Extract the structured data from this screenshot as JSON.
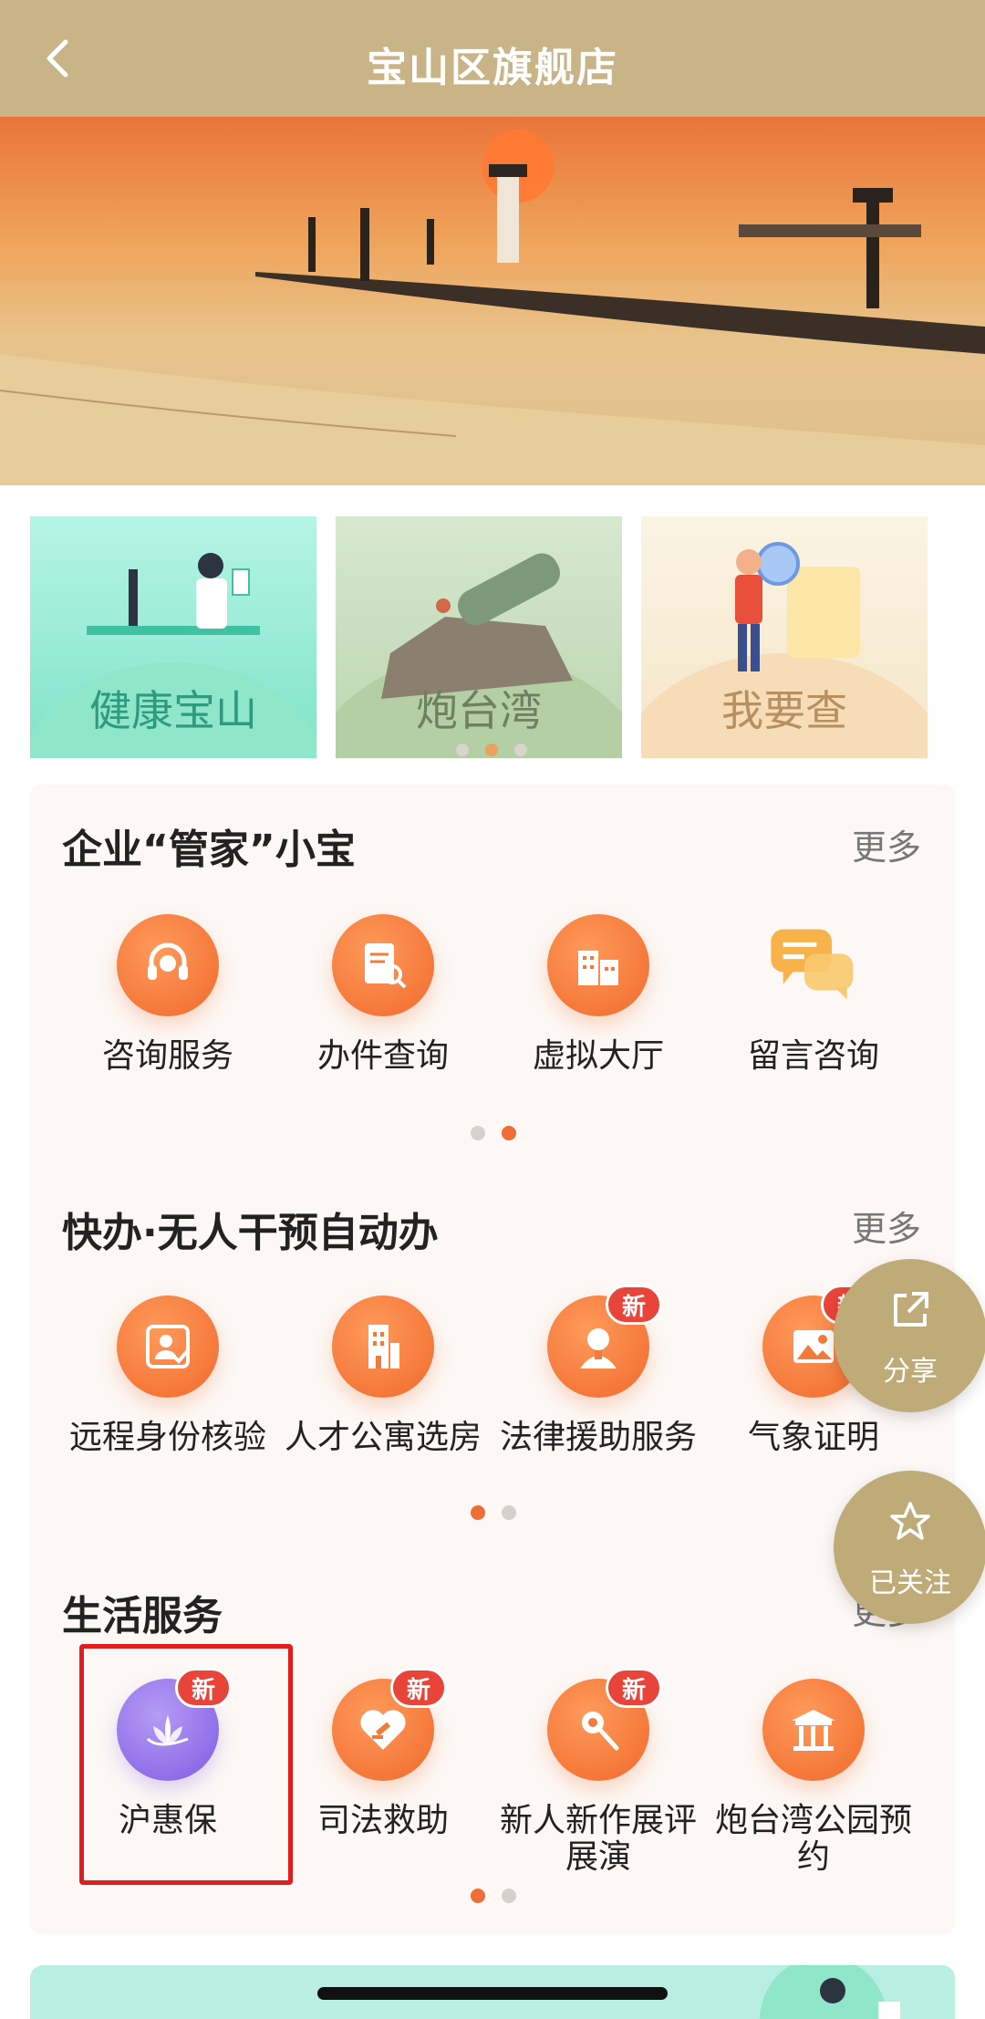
{
  "header": {
    "title": "宝山区旗舰店"
  },
  "cards": [
    {
      "label": "健康宝山"
    },
    {
      "label": "炮台湾"
    },
    {
      "label": "我要查"
    }
  ],
  "sections": [
    {
      "title": "企业“管家”小宝",
      "more": "更多",
      "items": [
        {
          "label": "咨询服务",
          "icon": "headset-icon"
        },
        {
          "label": "办件查询",
          "icon": "document-search-icon"
        },
        {
          "label": "虚拟大厅",
          "icon": "building-icon"
        },
        {
          "label": "留言咨询",
          "icon": "chat-bubbles-icon"
        }
      ]
    },
    {
      "title": "快办·无人干预自动办",
      "more": "更多",
      "items": [
        {
          "label": "远程身份核验",
          "icon": "id-verify-icon"
        },
        {
          "label": "人才公寓选房",
          "icon": "apartment-icon"
        },
        {
          "label": "法律援助服务",
          "icon": "lawyer-icon",
          "badge": "新"
        },
        {
          "label": "气象证明",
          "icon": "weather-photo-icon",
          "badge": "新"
        }
      ]
    },
    {
      "title": "生活服务",
      "more": "更多",
      "items": [
        {
          "label": "沪惠保",
          "icon": "lotus-icon",
          "badge": "新"
        },
        {
          "label": "司法救助",
          "icon": "heart-aid-icon",
          "badge": "新"
        },
        {
          "label": "新人新作展评展演",
          "icon": "candy-icon",
          "badge": "新"
        },
        {
          "label": "炮台湾公园预约",
          "icon": "pavilion-icon"
        }
      ]
    }
  ],
  "floating": {
    "share": "分享",
    "follow": "已关注"
  },
  "colors": {
    "nav": "#c8b486",
    "accent": "#ef6e35",
    "badge": "#e8443a",
    "highlight": "#e31c1c"
  }
}
